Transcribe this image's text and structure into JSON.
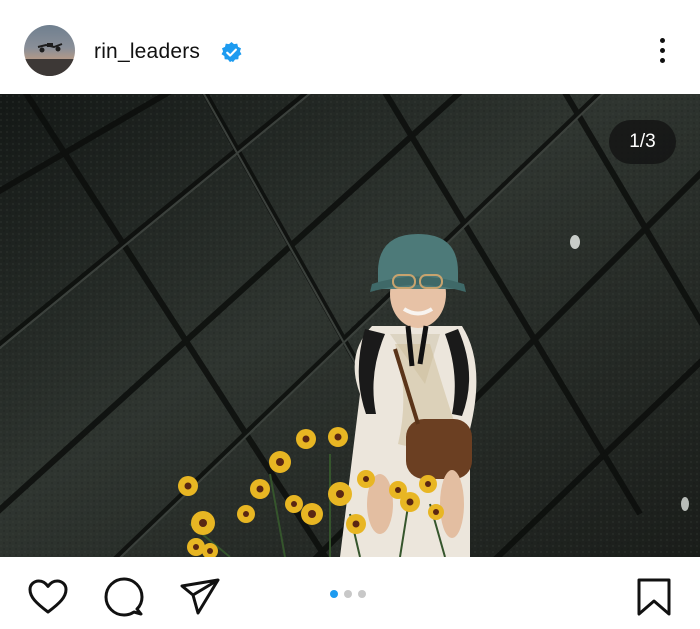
{
  "post": {
    "username": "rin_leaders",
    "verified": true,
    "image_counter": "1/3",
    "carousel": {
      "total": 3,
      "active": 1
    }
  },
  "icons": {
    "verified": "verified-badge-icon",
    "more": "more-options-icon",
    "like": "heart-icon",
    "comment": "comment-icon",
    "share": "paper-plane-icon",
    "save": "bookmark-icon"
  },
  "colors": {
    "verified": "#1d9bf0",
    "carousel_active": "#1d9bf0",
    "carousel_inactive": "#c8c8c8"
  }
}
